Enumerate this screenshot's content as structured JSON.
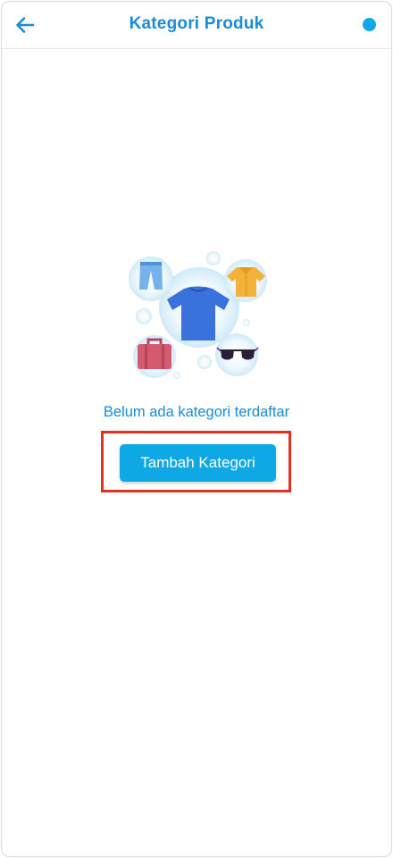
{
  "appbar": {
    "title": "Kategori Produk",
    "back_icon": "arrow-left-icon",
    "status_dot_color": "#12a7e8"
  },
  "empty_state": {
    "illustration": [
      "pants-icon",
      "tshirt-icon",
      "shirt-icon",
      "suitcase-icon",
      "sunglasses-icon"
    ],
    "message": "Belum ada kategori terdaftar",
    "add_button_label": "Tambah Kategori"
  },
  "colors": {
    "accent": "#1a8bd6",
    "button": "#0ea8e6",
    "highlight": "#e0331f"
  }
}
